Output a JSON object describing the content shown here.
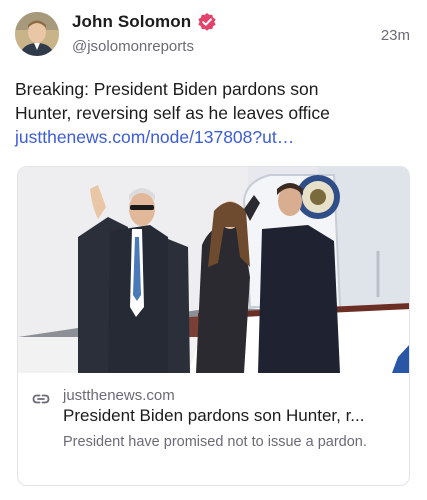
{
  "author": {
    "name": "John Solomon",
    "handle": "@jsolomonreports",
    "time": "23m",
    "avatar_icon": "avatar-photo",
    "verified_icon": "verified-badge-icon",
    "verified_color": "#e4416b"
  },
  "post": {
    "text_lines": [
      "Breaking: President Biden pardons son",
      "Hunter, reversing self as he leaves office"
    ],
    "link": "justthenews.com/node/137808?ut…",
    "link_color": "#3d5cd8"
  },
  "card": {
    "image_alt_icon": "news-photo",
    "domain": "justthenews.com",
    "title": "President Biden pardons son Hunter, r...",
    "description": "President have promised not to issue a pardon.",
    "link_icon": "link-icon"
  }
}
